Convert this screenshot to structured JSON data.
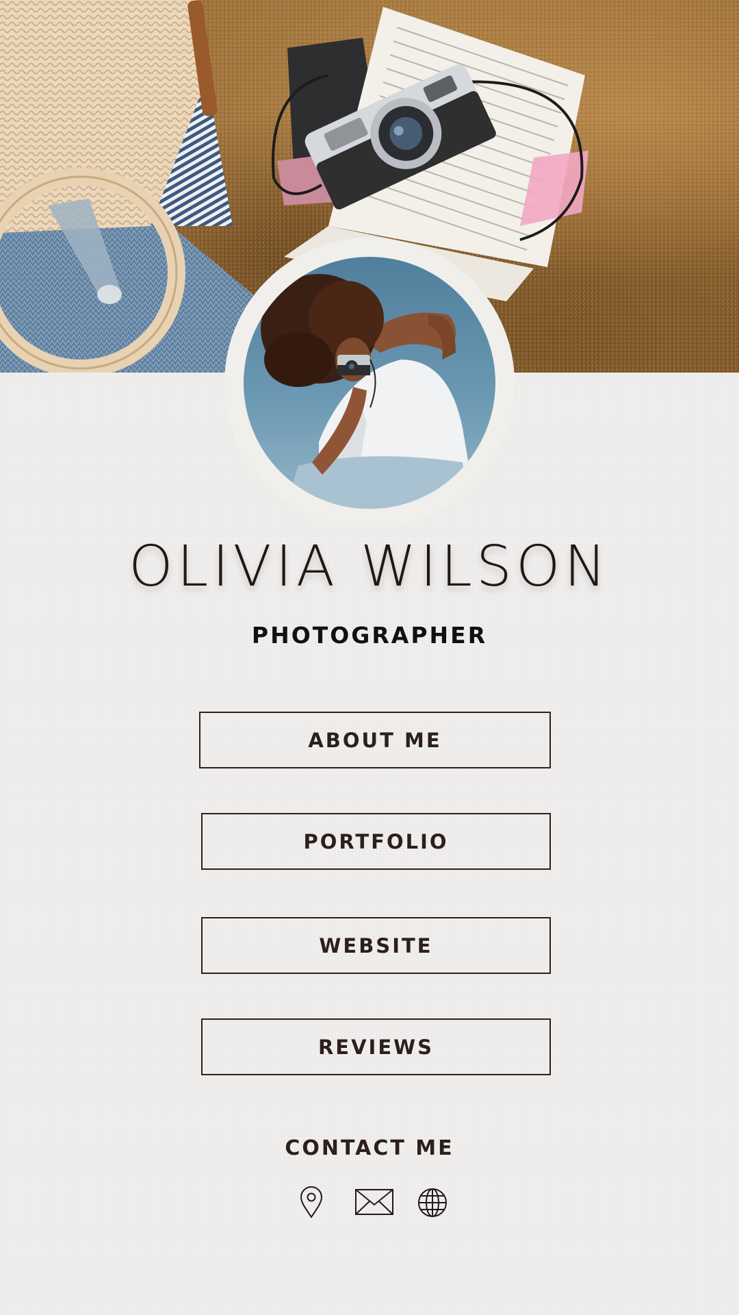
{
  "profile": {
    "name": "OLIVIA WILSON",
    "title": "PHOTOGRAPHER"
  },
  "links": {
    "about_label": "ABOUT ME",
    "portfolio_label": "PORTFOLIO",
    "website_label": "WEBSITE",
    "reviews_label": "REVIEWS"
  },
  "contact": {
    "title": "CONTACT ME",
    "icons": [
      "location-pin-icon",
      "mail-icon",
      "globe-icon"
    ]
  },
  "colors": {
    "background": "#f0efed",
    "text": "#2a1f1d",
    "border": "#2a2020"
  }
}
